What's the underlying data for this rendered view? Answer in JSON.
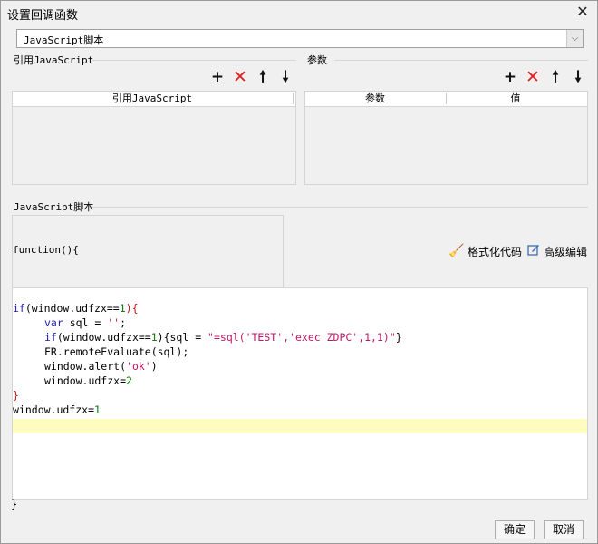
{
  "dialog": {
    "title": "设置回调函数",
    "close_symbol": "✕"
  },
  "script_type": {
    "selected": "JavaScript脚本"
  },
  "ref_js": {
    "label": "引用JavaScript",
    "column_header": "引用JavaScript"
  },
  "params": {
    "label": "参数",
    "columns": [
      "参数",
      "值"
    ]
  },
  "toolbar_icons": [
    "plus-icon",
    "delete-x-icon",
    "arrow-up-icon",
    "arrow-down-icon"
  ],
  "script": {
    "label": "JavaScript脚本",
    "function_header": "function(){",
    "format_label": "格式化代码",
    "advanced_label": "高级编辑",
    "closing_brace": "}",
    "lines": {
      "l1": {
        "a": "if",
        "b": "(window.udfzx==",
        "c": "1",
        "d": "){"
      },
      "l2": {
        "a": "var",
        "b": " sql = ",
        "c": "''",
        "d": ";"
      },
      "l3": {
        "a": "if",
        "b": "(window.udfzx==",
        "c": "1",
        "d": "){sql = ",
        "e": "\"=sql('TEST','exec ZDPC',1,1)\"",
        "f": "}"
      },
      "l4": {
        "a": "FR.remoteEvaluate(sql);"
      },
      "l5": {
        "a": "window.alert(",
        "b": "'ok'",
        "c": ")"
      },
      "l6": {
        "a": "window.udfzx=",
        "b": "2"
      },
      "l7": {
        "a": "}"
      },
      "l8": {
        "a": "window.udfzx=",
        "b": "1"
      }
    }
  },
  "buttons": {
    "ok": "确定",
    "cancel": "取消"
  },
  "colors": {
    "keyword": "#1a1ab0",
    "string": "#c0156a",
    "number": "#0d7a0d",
    "brace_red": "#d31010",
    "delete_red": "#e0201e",
    "current_line": "#fefcbf"
  }
}
